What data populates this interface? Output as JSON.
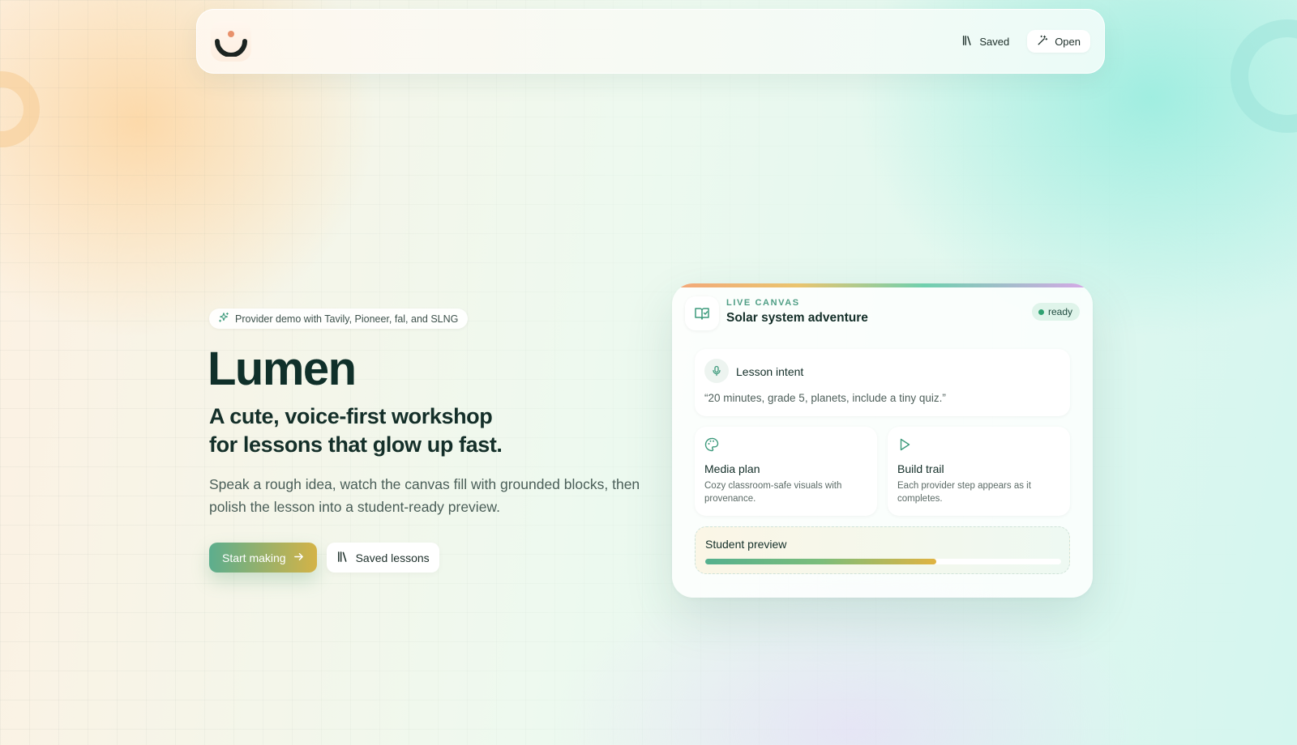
{
  "nav": {
    "saved_label": "Saved",
    "open_label": "Open"
  },
  "hero": {
    "badge_text": "Provider demo with Tavily, Pioneer, fal, and SLNG",
    "title": "Lumen",
    "subtitle_line1": "A cute, voice-first workshop",
    "subtitle_line2": "for lessons that glow up fast.",
    "description": "Speak a rough idea, watch the canvas fill with grounded blocks, then polish the lesson into a student-ready preview.",
    "primary_cta": "Start making",
    "secondary_cta": "Saved lessons"
  },
  "canvas": {
    "kicker": "LIVE CANVAS",
    "title": "Solar system adventure",
    "status": "ready",
    "intent": {
      "label": "Lesson intent",
      "quote": "“20 minutes, grade 5, planets, include a tiny quiz.”"
    },
    "media_plan": {
      "title": "Media plan",
      "description": "Cozy classroom-safe visuals with provenance."
    },
    "build_trail": {
      "title": "Build trail",
      "description": "Each provider step appears as it completes."
    },
    "preview": {
      "label": "Student preview",
      "progress_fraction": 0.65
    }
  },
  "colors": {
    "accent_green": "#4f9e85",
    "status_green": "#2fa271",
    "text_dark": "#142f29",
    "cta_gradient_start": "#5cae8e",
    "cta_gradient_end": "#d4b347"
  },
  "icons": {
    "logo": "smile-logo-icon",
    "saved": "library-icon",
    "open": "magic-wand-icon",
    "badge": "sparkles-icon",
    "arrow": "arrow-right-icon",
    "card": "book-check-icon",
    "intent": "microphone-icon",
    "media": "palette-icon",
    "build": "play-icon"
  }
}
